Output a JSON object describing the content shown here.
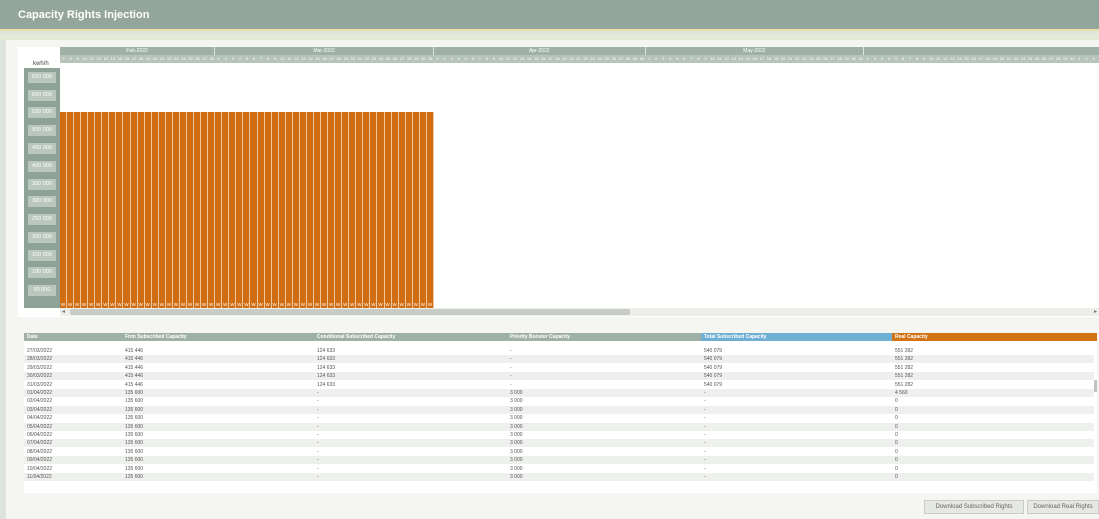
{
  "app": {
    "title": "Capacity Rights Injection"
  },
  "chart": {
    "y_unit": "kwh/h",
    "y_ticks": [
      "650 000",
      "600 000",
      "550 000",
      "500 000",
      "450 000",
      "400 000",
      "350 000",
      "300 000",
      "250 000",
      "200 000",
      "150 000",
      "100 000",
      "50 000"
    ],
    "months": [
      "Feb-2022",
      "Mar-2022",
      "Apr-2022",
      "May-2022"
    ],
    "bar_day_label": "W",
    "scroll_left_icon": "arrow-left-icon",
    "scroll_right_icon": "arrow-right-icon"
  },
  "chart_data": {
    "type": "bar",
    "ylabel": "kwh/h",
    "ylim": [
      0,
      675000
    ],
    "x_start": "2022-02-07",
    "x_months": [
      "Feb-2022",
      "Mar-2022",
      "Apr-2022",
      "May-2022"
    ],
    "series": [
      {
        "color": "#d06d12",
        "values": [
          551282,
          551282,
          551282,
          551282,
          551282,
          551282,
          551282,
          551282,
          551282,
          551282,
          551282,
          551282,
          551282,
          551282,
          551282,
          551282,
          551282,
          551282,
          551282,
          551282,
          551282,
          551282,
          551282,
          551282,
          551282,
          551282,
          551282,
          551282,
          551282,
          551282,
          551282,
          551282,
          551282,
          551282,
          551282,
          551282,
          551282,
          551282,
          551282,
          551282,
          551282,
          551282,
          551282,
          551282,
          551282,
          551282,
          551282,
          551282,
          551282,
          551282,
          551282,
          551282,
          551282
        ]
      }
    ]
  },
  "table": {
    "columns": [
      "Date",
      "Firm Subscribed Capacity",
      "Conditional Subscribed Capacity",
      "Priority Booster Capacity",
      "Total Subscribed Capacity",
      "Real Capacity"
    ],
    "rows": [
      [
        "27/03/2022",
        "415 446",
        "124 633",
        "-",
        "540 079",
        "551 282"
      ],
      [
        "28/03/2022",
        "415 446",
        "124 633",
        "-",
        "540 079",
        "551 282"
      ],
      [
        "29/03/2022",
        "415 446",
        "124 633",
        "-",
        "540 079",
        "551 282"
      ],
      [
        "30/03/2022",
        "415 446",
        "124 633",
        "-",
        "540 079",
        "551 282"
      ],
      [
        "31/03/2022",
        "415 446",
        "124 633",
        "-",
        "540 079",
        "551 282"
      ],
      [
        "01/04/2022",
        "135 600",
        "-",
        "3 000",
        "-",
        "4 560"
      ],
      [
        "02/04/2022",
        "135 600",
        "-",
        "3 000",
        "-",
        "0"
      ],
      [
        "03/04/2022",
        "135 600",
        "-",
        "3 000",
        "-",
        "0"
      ],
      [
        "04/04/2022",
        "135 600",
        "-",
        "3 000",
        "-",
        "0"
      ],
      [
        "05/04/2022",
        "135 600",
        "-",
        "3 000",
        "-",
        "0"
      ],
      [
        "06/04/2022",
        "135 600",
        "-",
        "3 000",
        "-",
        "0"
      ],
      [
        "07/04/2022",
        "135 600",
        "-",
        "3 000",
        "-",
        "0"
      ],
      [
        "08/04/2022",
        "135 600",
        "-",
        "3 000",
        "-",
        "0"
      ],
      [
        "09/04/2022",
        "135 600",
        "-",
        "3 000",
        "-",
        "0"
      ],
      [
        "10/04/2022",
        "135 600",
        "-",
        "3 000",
        "-",
        "0"
      ],
      [
        "11/04/2022",
        "135 600",
        "-",
        "3 000",
        "-",
        "0"
      ]
    ]
  },
  "buttons": {
    "download_subscribed": "Download Subscribed Rights",
    "download_real": "Download Real Rights"
  }
}
